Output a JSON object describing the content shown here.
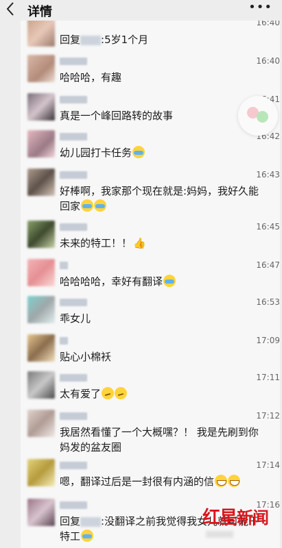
{
  "header": {
    "back_icon": "chevron-left-icon",
    "title": "详情",
    "more_icon": "more-dots-icon",
    "more_glyph": "•••"
  },
  "comments": [
    {
      "time": "16:40",
      "text": "5岁1个月",
      "reply_prefix": "回复",
      "reply_suffix": ":"
    },
    {
      "time": "16:40",
      "text": "哈哈哈，有趣"
    },
    {
      "time": "16:41",
      "text": "真是一个峰回路转的故事"
    },
    {
      "time": "16:42",
      "text": "幼儿园打卡任务"
    },
    {
      "time": "16:43",
      "text": "好棒啊，我家那个现在就是:妈妈，我好久能回家"
    },
    {
      "time": "16:45",
      "text": "未来的特工！！"
    },
    {
      "time": "16:47",
      "text": "哈哈哈哈，幸好有翻译"
    },
    {
      "time": "16:53",
      "text": "乖女儿"
    },
    {
      "time": "17:09",
      "text": "贴心小棉袄"
    },
    {
      "time": "17:11",
      "text": "太有爱了"
    },
    {
      "time": "17:12",
      "text": "我居然看懂了一个大概嘿？！ 我是先刷到你妈发的盆友圈"
    },
    {
      "time": "17:14",
      "text": "嗯，翻译过后是一封很有内涵的信"
    },
    {
      "time": "17:16",
      "text": "没翻译之前我觉得我女儿就可能干特工",
      "reply_prefix": "回复",
      "reply_suffix": ":"
    }
  ],
  "watermark": {
    "brand": "红星",
    "sub": "新闻"
  },
  "float_icon": "emoji-sticker-icon"
}
